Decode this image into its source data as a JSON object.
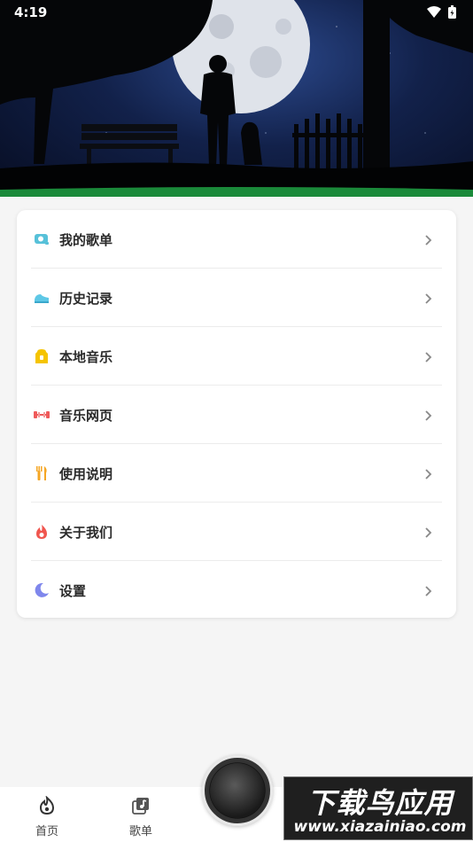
{
  "status_bar": {
    "time": "4:19"
  },
  "menu": {
    "items": [
      {
        "label": "我的歌单",
        "icon": "playlist-icon",
        "color": "#57c1d9"
      },
      {
        "label": "历史记录",
        "icon": "history-icon",
        "color": "#5ec8e6"
      },
      {
        "label": "本地音乐",
        "icon": "local-music-icon",
        "color": "#f5c400"
      },
      {
        "label": "音乐网页",
        "icon": "music-web-icon",
        "color": "#ef5a5a"
      },
      {
        "label": "使用说明",
        "icon": "instructions-icon",
        "color": "#f5a623"
      },
      {
        "label": "关于我们",
        "icon": "about-us-icon",
        "color": "#f0564f"
      },
      {
        "label": "设置",
        "icon": "settings-icon",
        "color": "#7f87ec"
      }
    ]
  },
  "bottom_nav": {
    "tabs": [
      {
        "label": "首页",
        "icon": "home-flame-icon"
      },
      {
        "label": "歌单",
        "icon": "playlist-tab-icon"
      }
    ]
  },
  "watermark": {
    "title": "下载鸟应用",
    "url": "www.xiazainiao.com"
  }
}
